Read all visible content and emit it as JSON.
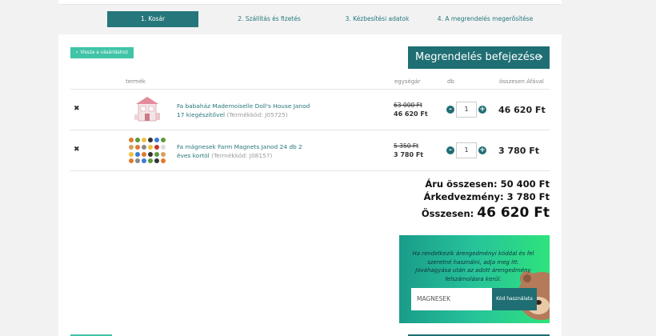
{
  "steps": [
    {
      "label": "1. Kosár"
    },
    {
      "label": "2. Szállítás és fizetés"
    },
    {
      "label": "3. Kézbesítési adatok"
    },
    {
      "label": "4. A megrendelés megerősítése"
    }
  ],
  "buttons": {
    "back": "Vissza a vásárláshoz",
    "finish": "Megrendelés befejezése"
  },
  "table": {
    "headers": {
      "product": "termék",
      "unit_price": "egységár",
      "qty": "db",
      "total": "összesen Áfával"
    }
  },
  "items": [
    {
      "name": "Fa babaház Mademoiselle Doll's House Janod 17 kiegészítővel",
      "code": "(Termékkód: J05725)",
      "old_price": "63 000 Ft",
      "price": "46 620 Ft",
      "qty": "1",
      "total": "46 620 Ft"
    },
    {
      "name": "Fa mágnesek Farm Magnets Janod 24 db 2 éves kortól",
      "code": "(Termékkód: J08157)",
      "old_price": "5 350 Ft",
      "price": "3 780 Ft",
      "qty": "1",
      "total": "3 780 Ft"
    }
  ],
  "summary": {
    "goods_label": "Áru összesen:",
    "goods_value": "50 400 Ft",
    "discount_label": "Árkedvezmény:",
    "discount_value": "3 780 Ft",
    "total_label": "Összesen:",
    "total_value": "46 620 Ft"
  },
  "coupon": {
    "text": "Ha rendelkezik árengedményi kóddal és fel szeretné használni, adja meg itt. Jóváhagyása után az adott árengedmény felszámolásra kerül.",
    "input_value": "MAGNESEK",
    "button": "Kód használata"
  },
  "colors": {
    "teal_dark": "#1f6e73",
    "teal_light": "#40c4a6",
    "link": "#25777c"
  }
}
